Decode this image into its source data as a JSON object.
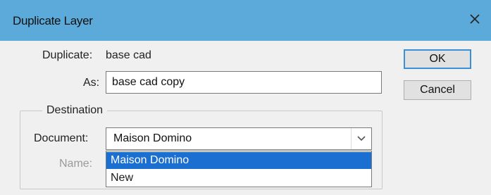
{
  "window": {
    "title": "Duplicate Layer",
    "close_icon": "close-icon"
  },
  "form": {
    "duplicate_label": "Duplicate:",
    "duplicate_value": "base cad",
    "as_label": "As:",
    "as_value": "base cad copy"
  },
  "buttons": {
    "ok_label": "OK",
    "cancel_label": "Cancel"
  },
  "destination": {
    "legend": "Destination",
    "document_label": "Document:",
    "document_value": "Maison Domino",
    "name_label": "Name:",
    "options": [
      {
        "label": "Maison Domino",
        "selected": true
      },
      {
        "label": "New",
        "selected": false
      }
    ]
  },
  "colors": {
    "titlebar": "#5caad9",
    "selection": "#1a6fd1",
    "default_button_border": "#3b8fd6"
  }
}
